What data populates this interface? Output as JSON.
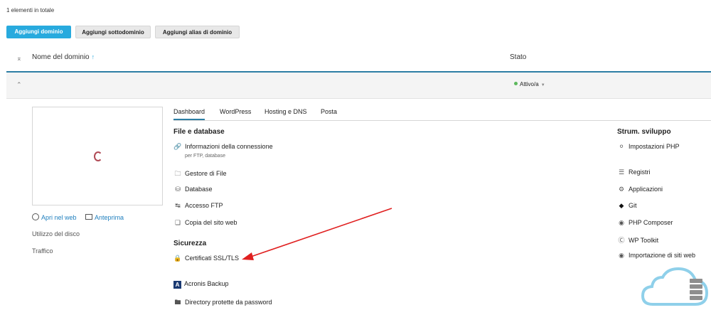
{
  "list": {
    "total_label": "1 elementi in totale"
  },
  "toolbar": {
    "add_domain": "Aggiungi dominio",
    "add_subdomain": "Aggiungi sottodominio",
    "add_alias": "Aggiungi alias di dominio"
  },
  "table": {
    "col_domain": "Nome del dominio",
    "col_domain_sort": "↑",
    "col_state": "Stato",
    "row": {
      "status": "Attivo/a",
      "status_color": "#5cb85c"
    }
  },
  "domain_panel": {
    "open_web": "Apri nel web",
    "preview": "Anteprima",
    "disk_usage": "Utilizzo del disco",
    "traffic": "Traffico"
  },
  "tabs": [
    "Dashboard",
    "WordPress",
    "Hosting e DNS",
    "Posta"
  ],
  "files_db": {
    "title": "File e database",
    "connection_info": "Informazioni della connessione",
    "connection_sub": "per FTP, database",
    "file_manager": "Gestore di File",
    "database": "Database",
    "ftp_access": "Accesso FTP",
    "site_copy": "Copia del sito web"
  },
  "security": {
    "title": "Sicurezza",
    "ssl": "Certificati SSL/TLS",
    "acronis": "Acronis Backup",
    "protected_dirs": "Directory protette da password"
  },
  "dev_tools": {
    "title": "Strum. sviluppo",
    "php_settings": "Impostazioni PHP",
    "logs": "Registri",
    "applications": "Applicazioni",
    "git": "Git",
    "php_composer": "PHP Composer",
    "wp_toolkit": "WP Toolkit",
    "site_import": "Importazione di siti web"
  },
  "colors": {
    "accent": "#28aade",
    "tab_underline": "#2d7ea4",
    "annotation_arrow": "#e02020"
  }
}
